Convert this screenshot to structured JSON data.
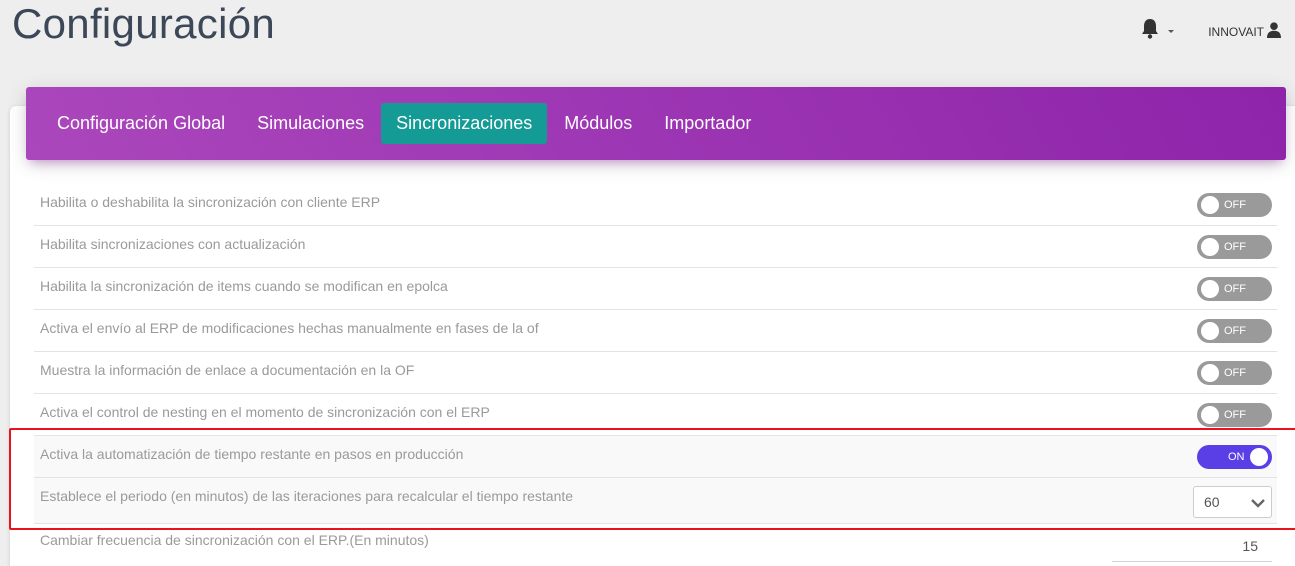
{
  "header": {
    "title": "Configuración",
    "user_name": "INNOVAIT",
    "bell_icon": "bell-icon",
    "user_icon": "user-icon"
  },
  "tabs": [
    {
      "label": "Configuración Global",
      "active": false
    },
    {
      "label": "Simulaciones",
      "active": false
    },
    {
      "label": "Sincronizaciones",
      "active": true
    },
    {
      "label": "Módulos",
      "active": false
    },
    {
      "label": "Importador",
      "active": false
    }
  ],
  "settings": [
    {
      "label": "Habilita o deshabilita la sincronización con cliente ERP",
      "state": "OFF"
    },
    {
      "label": "Habilita sincronizaciones con actualización",
      "state": "OFF"
    },
    {
      "label": "Habilita la sincronización de items cuando se modifican en epolca",
      "state": "OFF"
    },
    {
      "label": "Activa el envío al ERP de modificaciones hechas manualmente en fases de la of",
      "state": "OFF"
    },
    {
      "label": "Muestra la información de enlace a documentación en la OF",
      "state": "OFF"
    },
    {
      "label": "Activa el control de nesting en el momento de sincronización con el ERP",
      "state": "OFF"
    },
    {
      "label": "Activa la automatización de tiempo restante en pasos en producción",
      "state": "ON"
    }
  ],
  "period": {
    "label": "Establece el periodo (en minutos) de las iteraciones para recalcular el tiempo restante",
    "value": "60"
  },
  "frequency": {
    "label": "Cambiar frecuencia de sincronización con el ERP.(En minutos)",
    "value": "15"
  },
  "colors": {
    "header_gradient": [
      "#ab47bc",
      "#8e24aa"
    ],
    "active_tab": "#159b95",
    "toggle_on": "#5a3ee6",
    "toggle_off": "#9a9a9a",
    "highlight": "#e8141c"
  }
}
